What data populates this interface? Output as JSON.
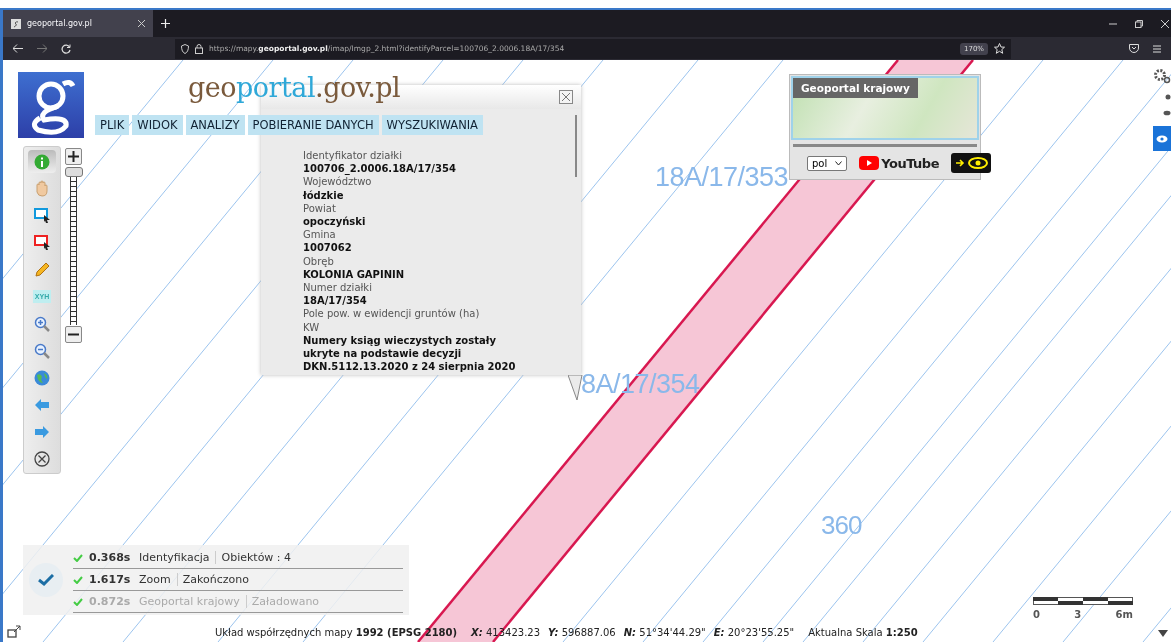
{
  "browser": {
    "tab_title": "geoportal.gov.pl",
    "url": {
      "prefix": "https://mapy.",
      "host": "geoportal.gov.pl",
      "path": "/imap/Imgp_2.html?identifyParcel=100706_2.0006.18A/17/354"
    },
    "zoom": "170%"
  },
  "logo": {
    "part1": "geo",
    "part2": "portal",
    "part3": ".gov.pl"
  },
  "menu": [
    "PLIK",
    "WIDOK",
    "ANALIZY",
    "POBIERANIE DANYCH",
    "WYSZUKIWANIA"
  ],
  "tools": [
    {
      "kind": "info",
      "selected": true
    },
    {
      "kind": "pan",
      "selected": false
    },
    {
      "kind": "select-blue",
      "selected": false
    },
    {
      "kind": "select-red",
      "selected": false
    },
    {
      "kind": "pencil",
      "selected": false
    },
    {
      "kind": "xyh",
      "label": "XYH",
      "selected": false
    },
    {
      "kind": "zoom-in",
      "selected": false
    },
    {
      "kind": "zoom-out",
      "selected": false
    },
    {
      "kind": "globe",
      "selected": false
    },
    {
      "kind": "back",
      "selected": false
    },
    {
      "kind": "forward",
      "selected": false
    },
    {
      "kind": "clear",
      "selected": false
    }
  ],
  "zoom_slider": {
    "level": 1
  },
  "popup": {
    "fields": [
      {
        "label": "Identyfikator działki",
        "value": "100706_2.0006.18A/17/354"
      },
      {
        "label": "Województwo",
        "value": "łódzkie"
      },
      {
        "label": "Powiat",
        "value": "opoczyński"
      },
      {
        "label": "Gmina",
        "value": "1007062"
      },
      {
        "label": "Obręb",
        "value": "KOLONIA GAPININ"
      },
      {
        "label": "Numer działki",
        "value": "18A/17/354"
      },
      {
        "label": "Pole pow. w ewidencji gruntów (ha)"
      },
      {
        "label": "KW",
        "value": "Numery ksiąg wieczystych zostały ukryte na podstawie decyzji DKN.5112.13.2020 z 24 sierpnia 2020"
      }
    ]
  },
  "map_labels": [
    {
      "text": "18A/17/353",
      "kind": "parcel"
    },
    {
      "text": "8A/17/354",
      "kind": "parcel"
    },
    {
      "text": "360",
      "kind": "number"
    }
  ],
  "overview": {
    "title": "Geoportal krajowy",
    "language": "pol",
    "youtube": "YouTube"
  },
  "log": [
    {
      "time": "0.368s",
      "operation": "Identyfikacja",
      "status": "Obiektów : 4",
      "faded": false
    },
    {
      "time": "1.617s",
      "operation": "Zoom",
      "status": "Zakończono",
      "faded": false
    },
    {
      "time": "0.872s",
      "operation": "Geoportal krajowy",
      "status": "Załadowano",
      "faded": true
    }
  ],
  "status_bar": {
    "system": "Układ współrzędnych mapy **1992 (EPSG 2180)**",
    "coords": [
      {
        "label": "X:",
        "value": "413423.23"
      },
      {
        "label": "Y:",
        "value": "596887.06"
      },
      {
        "label": "N:",
        "value": "51°34'44.29\""
      },
      {
        "label": "E:",
        "value": "20°23'55.25\""
      }
    ],
    "scale": "Aktualna Skala **1:250**"
  },
  "scalebar": [
    "0",
    "3",
    "6m"
  ]
}
